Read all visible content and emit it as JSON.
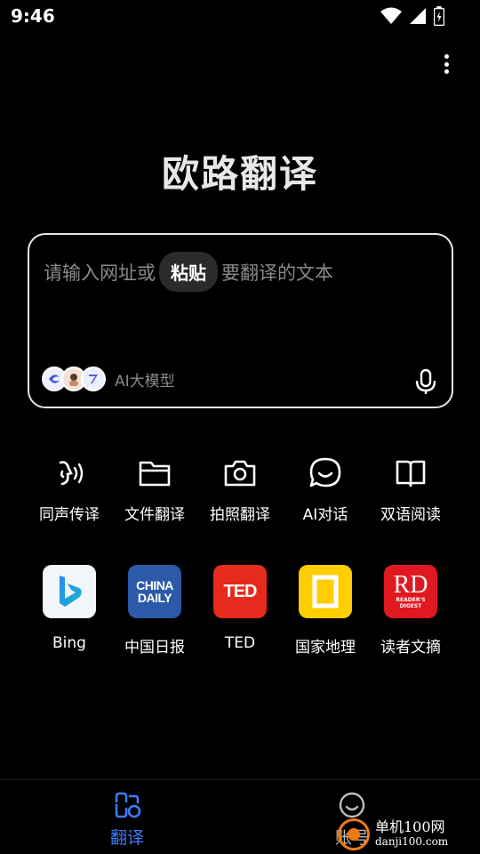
{
  "status_bar": {
    "time": "9:46"
  },
  "app": {
    "title": "欧路翻译"
  },
  "input": {
    "prompt_before": "请输入网址或",
    "paste_label": "粘贴",
    "prompt_after": "要翻译的文本",
    "model_label": "AI大模型"
  },
  "features": [
    {
      "label": "同声传译",
      "icon": "simultaneous-interpretation-icon"
    },
    {
      "label": "文件翻译",
      "icon": "folder-icon"
    },
    {
      "label": "拍照翻译",
      "icon": "camera-icon"
    },
    {
      "label": "AI对话",
      "icon": "chat-bubble-icon"
    },
    {
      "label": "双语阅读",
      "icon": "book-icon"
    }
  ],
  "sites": [
    {
      "label": "Bing",
      "logo_color": "#f2f6fb"
    },
    {
      "label": "中国日报",
      "logo_text_1": "CHINA",
      "logo_text_2": "DAILY",
      "logo_color": "#2c5aa8"
    },
    {
      "label": "TED",
      "logo_text": "TED",
      "logo_color": "#e62b1e"
    },
    {
      "label": "国家地理",
      "logo_color": "#ffce00"
    },
    {
      "label": "读者文摘",
      "logo_text": "RD",
      "logo_sub_1": "READER'S",
      "logo_sub_2": "DIGEST",
      "logo_color": "#e0181f"
    }
  ],
  "bottom_nav": [
    {
      "label": "翻译",
      "active": true,
      "color": "#3f7bff"
    },
    {
      "label": "账号",
      "active": false
    }
  ],
  "watermark": {
    "name": "单机100网",
    "url": "danji100.com"
  },
  "colors": {
    "background": "#000000",
    "accent": "#3f7bff",
    "box_border": "#e6e6e6",
    "placeholder": "#8a8a8a"
  }
}
